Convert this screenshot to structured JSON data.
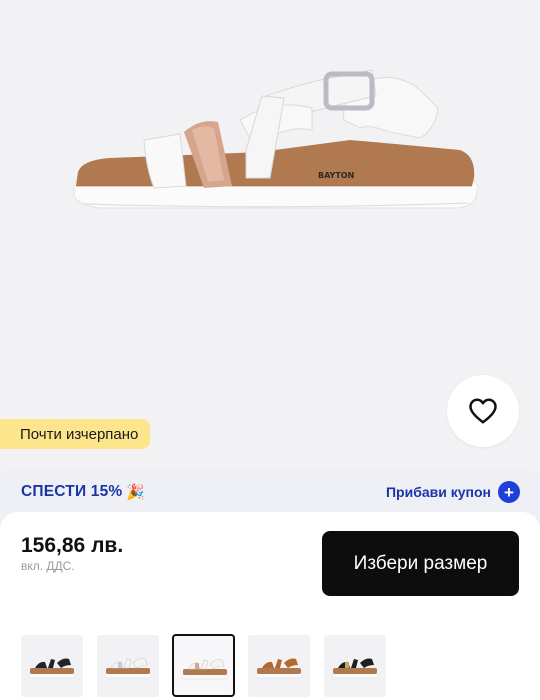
{
  "product": {
    "image": {
      "brand_mark": "BAYTON",
      "alt": "sandal"
    },
    "favorite_icon": "heart-icon",
    "stock_badge": "Почти изчерпано"
  },
  "promo": {
    "title": "СПЕСТИ 15%",
    "emoji": "🎉",
    "coupon_label": "Прибави купон",
    "coupon_icon": "+"
  },
  "purchase": {
    "price": "156,86 лв.",
    "vat_note": "вкл. ДДС.",
    "size_button": "Избери размер"
  },
  "thumbnails": [
    {
      "variant": "black",
      "strap": "#222428",
      "selected": false
    },
    {
      "variant": "white-silver",
      "strap": "#f4f4f4",
      "selected": false
    },
    {
      "variant": "white-rose-gold",
      "strap": "#f4f4f4",
      "selected": true
    },
    {
      "variant": "cognac",
      "strap": "#b5682c",
      "selected": false
    },
    {
      "variant": "black-gold",
      "strap": "#1f1f22",
      "selected": false
    }
  ],
  "colors": {
    "accent_blue": "#1b35a8",
    "badge_yellow": "#fde58b",
    "button_black": "#0d0d0d"
  }
}
